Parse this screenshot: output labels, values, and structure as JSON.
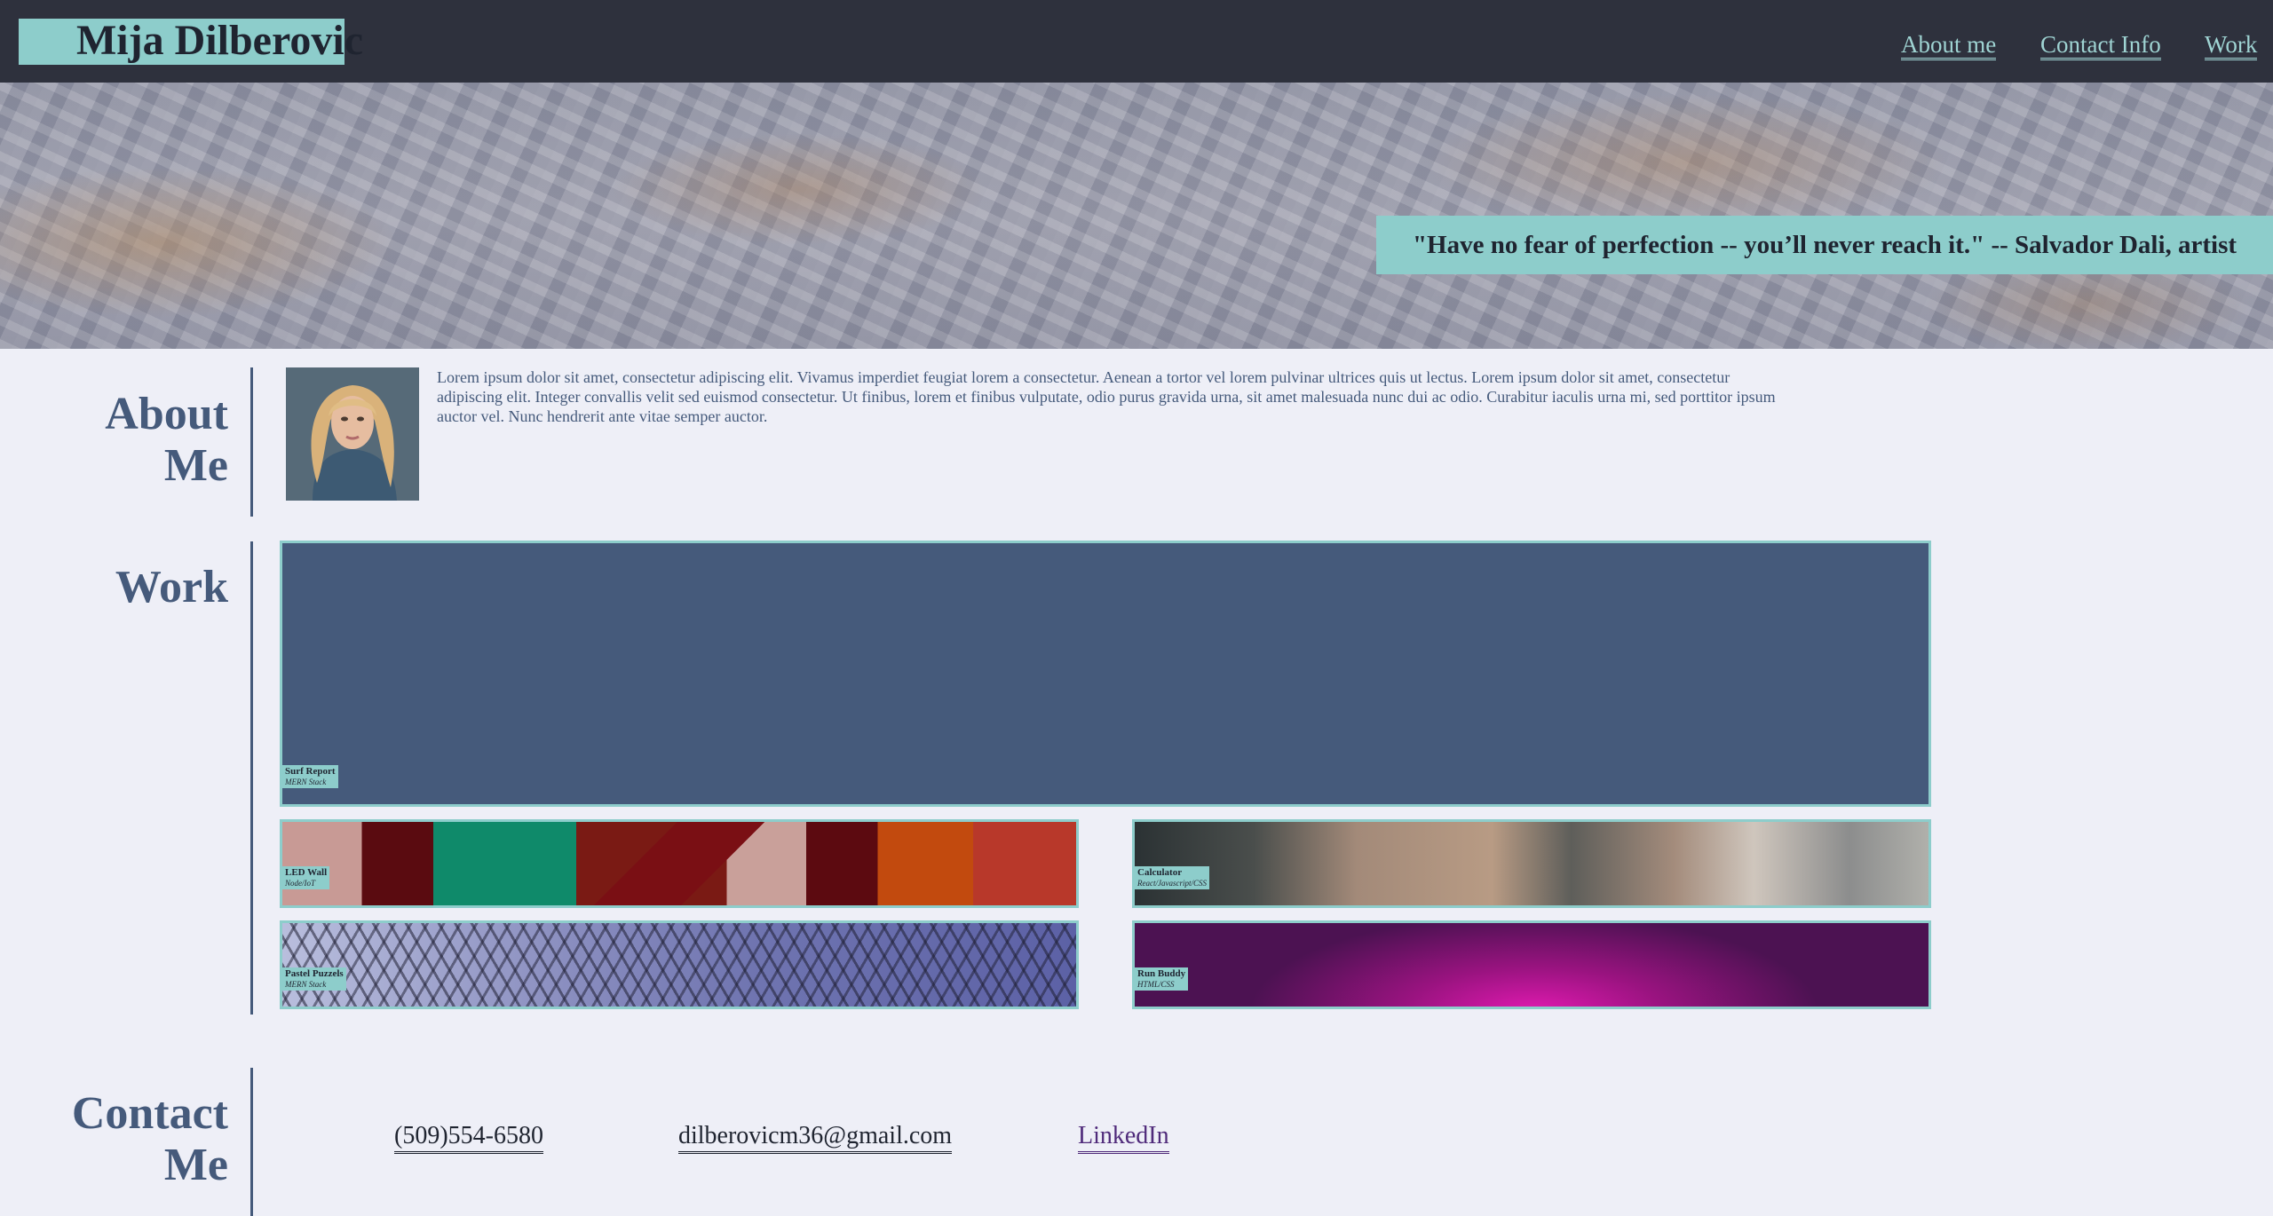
{
  "header": {
    "brand": "Mija Dilberovic",
    "nav": [
      {
        "label": "About me"
      },
      {
        "label": "Contact Info"
      },
      {
        "label": "Work"
      }
    ]
  },
  "hero": {
    "quote": "\"Have no fear of perfection -- you’ll never reach it.\" -- Salvador Dali, artist"
  },
  "about": {
    "title_line1": "About",
    "title_line2": "Me",
    "text": "Lorem ipsum dolor sit amet, consectetur adipiscing elit. Vivamus imperdiet feugiat lorem a consectetur. Aenean a tortor vel lorem pulvinar ultrices quis ut lectus. Lorem ipsum dolor sit amet, consectetur adipiscing elit. Integer convallis velit sed euismod consectetur. Ut finibus, lorem et finibus vulputate, odio purus gravida urna, sit amet malesuada nunc dui ac odio. Curabitur iaculis urna mi, sed porttitor ipsum auctor vel. Nunc hendrerit ante vitae semper auctor."
  },
  "work": {
    "title": "Work",
    "projects": [
      {
        "title": "Surf Report",
        "tech": "MERN Stack"
      },
      {
        "title": "LED Wall",
        "tech": "Node/IoT"
      },
      {
        "title": "Calculator",
        "tech": "React/Javascript/CSS"
      },
      {
        "title": "Pastel Puzzels",
        "tech": "MERN Stack"
      },
      {
        "title": "Run Buddy",
        "tech": "HTML/CSS"
      }
    ]
  },
  "contact": {
    "title_line1": "Contact",
    "title_line2": "Me",
    "phone": "(509)554-6580",
    "email": "dilberovicm36@gmail.com",
    "linkedin": "LinkedIn"
  },
  "colors": {
    "header_bg": "#2e313d",
    "accent": "#8dcdcb",
    "primary": "#455a7b",
    "page_bg": "#eeeff7"
  }
}
